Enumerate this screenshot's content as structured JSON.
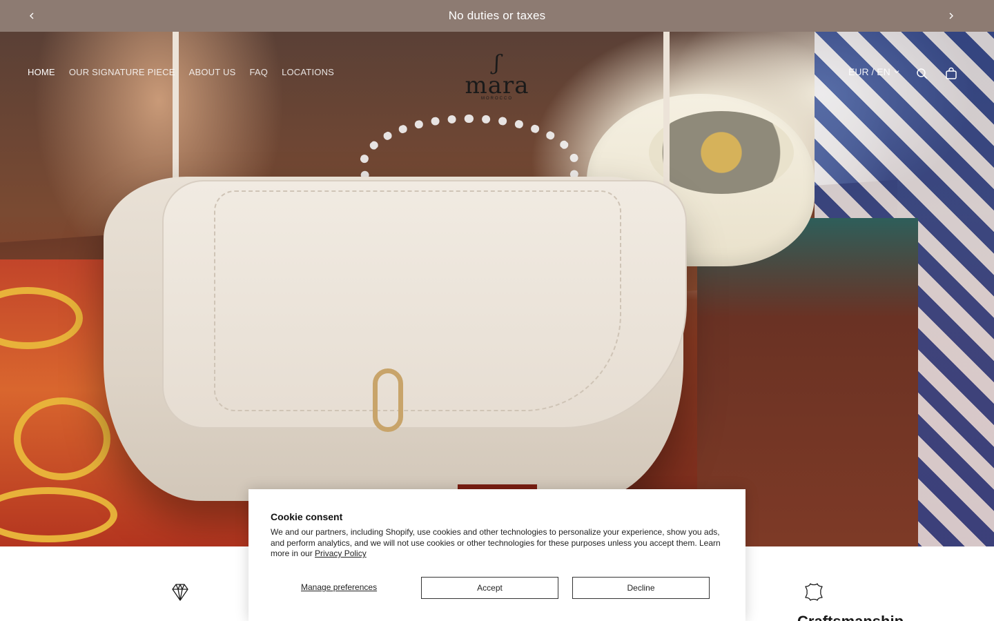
{
  "announcement": {
    "text": "No duties or taxes",
    "prev_icon": "chevron-left-icon",
    "next_icon": "chevron-right-icon"
  },
  "header": {
    "nav": [
      "HOME",
      "OUR SIGNATURE PIECE",
      "ABOUT US",
      "FAQ",
      "LOCATIONS"
    ],
    "logo": {
      "word": "mara",
      "sub": "MOROCCO"
    },
    "locale": "EUR / EN",
    "icons": [
      "search-icon",
      "bag-icon"
    ]
  },
  "features": [
    {
      "icon": "diamond-icon",
      "title": ""
    },
    {
      "icon": "leather-hide-icon",
      "title": "Craftsmanship"
    }
  ],
  "cookie": {
    "title": "Cookie consent",
    "body": "We and our partners, including Shopify, use cookies and other technologies to personalize your experience, show you ads, and perform analytics, and we will not use cookies or other technologies for these purposes unless you accept them. Learn more in our ",
    "policy_link": "Privacy Policy",
    "manage": "Manage preferences",
    "accept": "Accept",
    "decline": "Decline"
  },
  "colors": {
    "announcement_bg": "#8d7b72",
    "text": "#1a1a1a"
  }
}
